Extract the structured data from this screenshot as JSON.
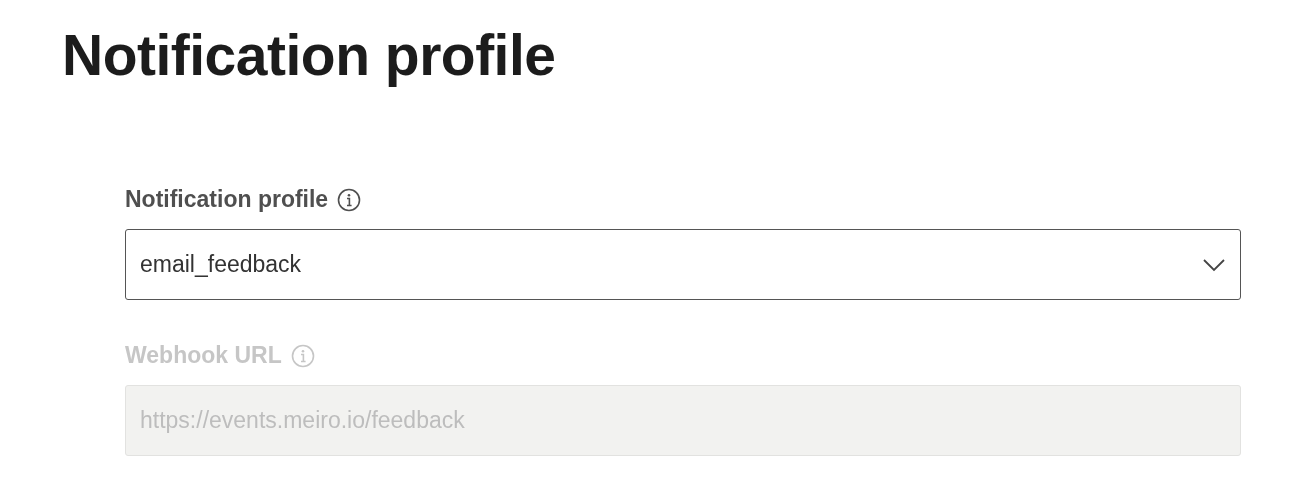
{
  "title": "Notification profile",
  "fields": [
    {
      "kind": "select",
      "label": "Notification profile",
      "value": "email_feedback",
      "disabled": false
    },
    {
      "kind": "text",
      "label": "Webhook URL",
      "value": "https://events.meiro.io/feedback",
      "disabled": true
    }
  ]
}
